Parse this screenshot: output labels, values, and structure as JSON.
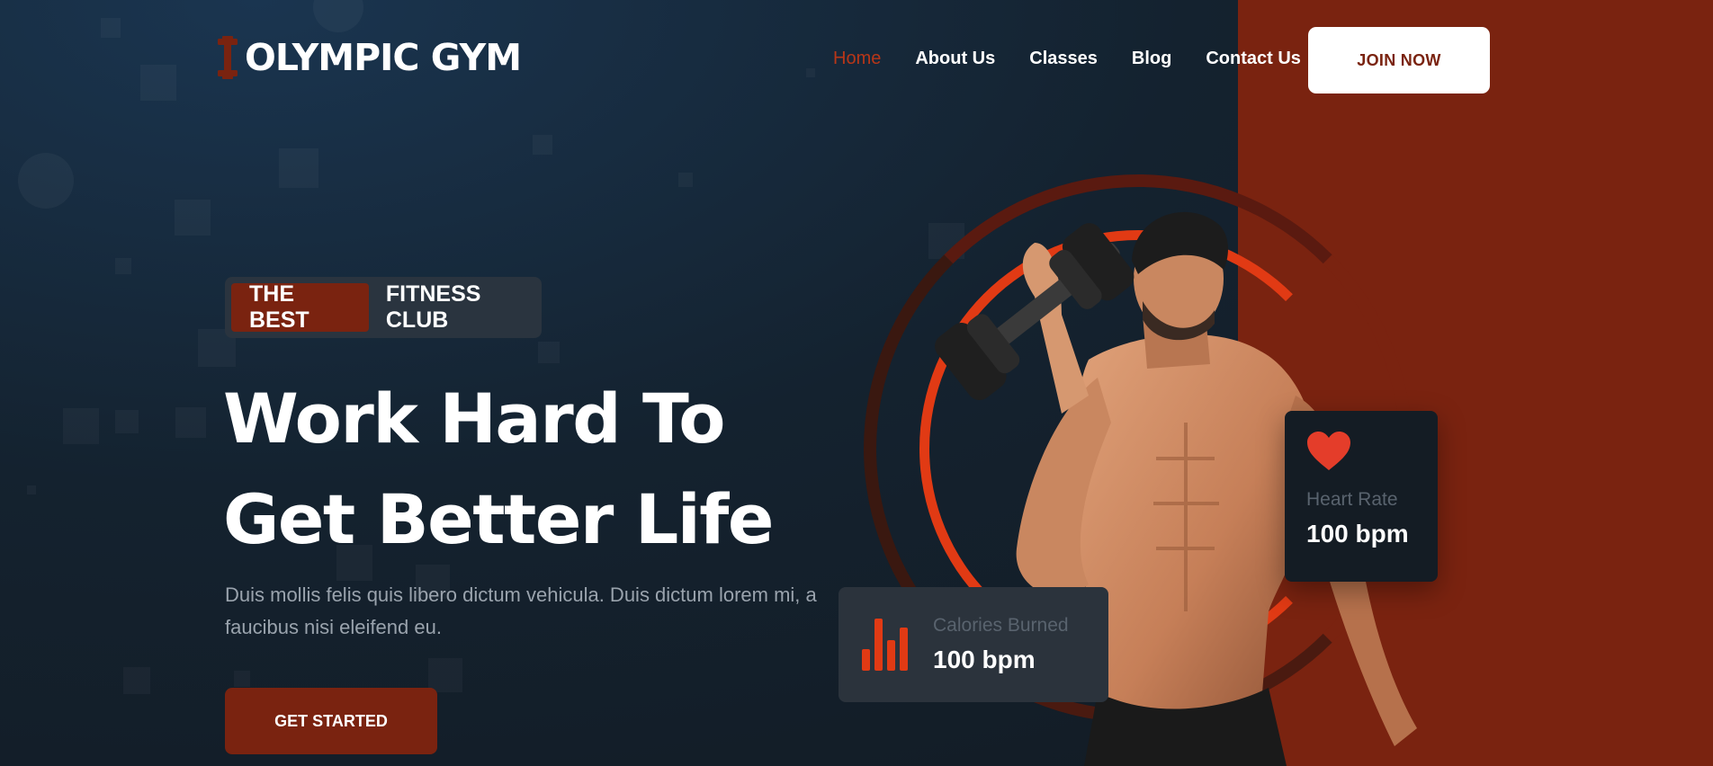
{
  "brand": {
    "name": "OLYMPIC GYM",
    "icon": "dumbbell-icon",
    "accent": "#7a2310",
    "highlight": "#e13a14"
  },
  "nav": {
    "items": [
      {
        "label": "Home",
        "active": true
      },
      {
        "label": "About Us",
        "active": false
      },
      {
        "label": "Classes",
        "active": false
      },
      {
        "label": "Blog",
        "active": false
      },
      {
        "label": "Contact Us",
        "active": false
      }
    ],
    "join_label": "JOIN NOW"
  },
  "hero": {
    "badge": "THE BEST",
    "badge_suffix": "FITNESS CLUB",
    "title_line1": "Work Hard To",
    "title_line2": "Get Better Life",
    "description": "Duis mollis felis quis libero dictum vehicula. Duis dictum lorem mi, a faucibus nisi eleifend eu.",
    "cta_label": "GET STARTED"
  },
  "stats": {
    "calories": {
      "label": "Calories Burned",
      "value": "100 bpm",
      "icon": "bar-chart-icon"
    },
    "heart": {
      "label": "Heart Rate",
      "value": "100 bpm",
      "icon": "heart-icon"
    }
  }
}
